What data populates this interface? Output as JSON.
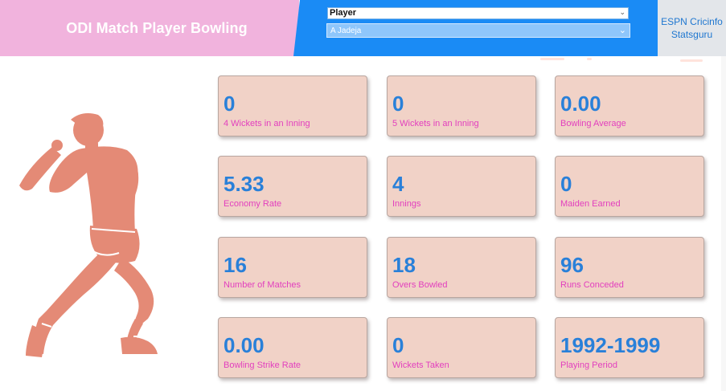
{
  "header": {
    "title": "ODI Match Player Bowling",
    "filter_field": "Player",
    "filter_value": "A Jadeja",
    "link_text": "ESPN Cricinfo Statsguru"
  },
  "colors": {
    "title_bg": "#f1b3dd",
    "filter_bg": "#1a8bf5",
    "card_bg": "#f1d2c7",
    "value_color": "#2980d9",
    "label_color": "#e23fbe",
    "figure_color": "#e48a76"
  },
  "figure_icon": "cricket-bowler-icon",
  "cards": [
    {
      "value": "0",
      "label": "4 Wickets in an Inning"
    },
    {
      "value": "0",
      "label": "5 Wickets in an Inning"
    },
    {
      "value": "0.00",
      "label": "Bowling Average"
    },
    {
      "value": "5.33",
      "label": "Economy Rate"
    },
    {
      "value": "4",
      "label": "Innings"
    },
    {
      "value": "0",
      "label": "Maiden Earned"
    },
    {
      "value": "16",
      "label": "Number of Matches"
    },
    {
      "value": "18",
      "label": "Overs Bowled"
    },
    {
      "value": "96",
      "label": "Runs Conceded"
    },
    {
      "value": "0.00",
      "label": "Bowling Strike Rate"
    },
    {
      "value": "0",
      "label": "Wickets Taken"
    },
    {
      "value": "1992-1999",
      "label": "Playing Period"
    }
  ]
}
